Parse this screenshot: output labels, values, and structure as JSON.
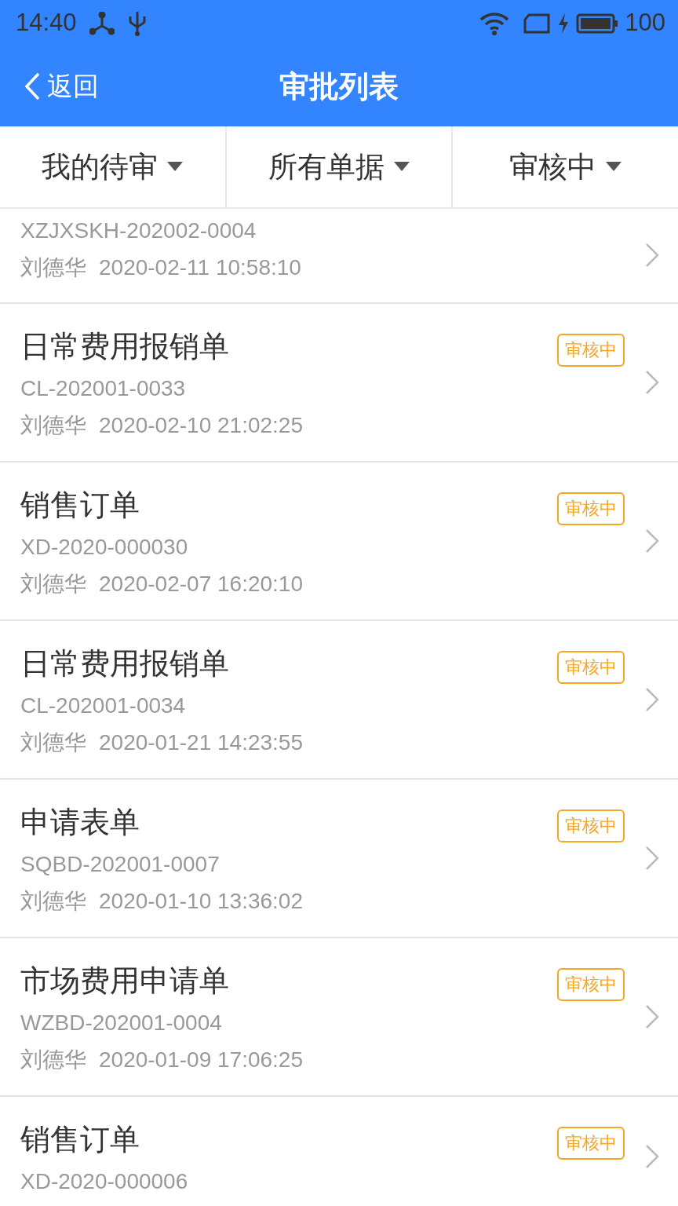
{
  "status_bar": {
    "time": "14:40",
    "battery": "100"
  },
  "header": {
    "back": "返回",
    "title": "审批列表"
  },
  "filters": [
    {
      "label": "我的待审"
    },
    {
      "label": "所有单据"
    },
    {
      "label": "审核中"
    }
  ],
  "items": [
    {
      "code": "XZJXSKH-202002-0004",
      "person": "刘德华",
      "datetime": "2020-02-11 10:58:10"
    },
    {
      "title": "日常费用报销单",
      "status": "审核中",
      "code": "CL-202001-0033",
      "person": "刘德华",
      "datetime": "2020-02-10 21:02:25"
    },
    {
      "title": "销售订单",
      "status": "审核中",
      "code": "XD-2020-000030",
      "person": "刘德华",
      "datetime": "2020-02-07 16:20:10"
    },
    {
      "title": "日常费用报销单",
      "status": "审核中",
      "code": "CL-202001-0034",
      "person": "刘德华",
      "datetime": "2020-01-21 14:23:55"
    },
    {
      "title": "申请表单",
      "status": "审核中",
      "code": "SQBD-202001-0007",
      "person": "刘德华",
      "datetime": "2020-01-10 13:36:02"
    },
    {
      "title": "市场费用申请单",
      "status": "审核中",
      "code": "WZBD-202001-0004",
      "person": "刘德华",
      "datetime": "2020-01-09 17:06:25"
    },
    {
      "title": "销售订单",
      "status": "审核中",
      "code": "XD-2020-000006"
    }
  ]
}
